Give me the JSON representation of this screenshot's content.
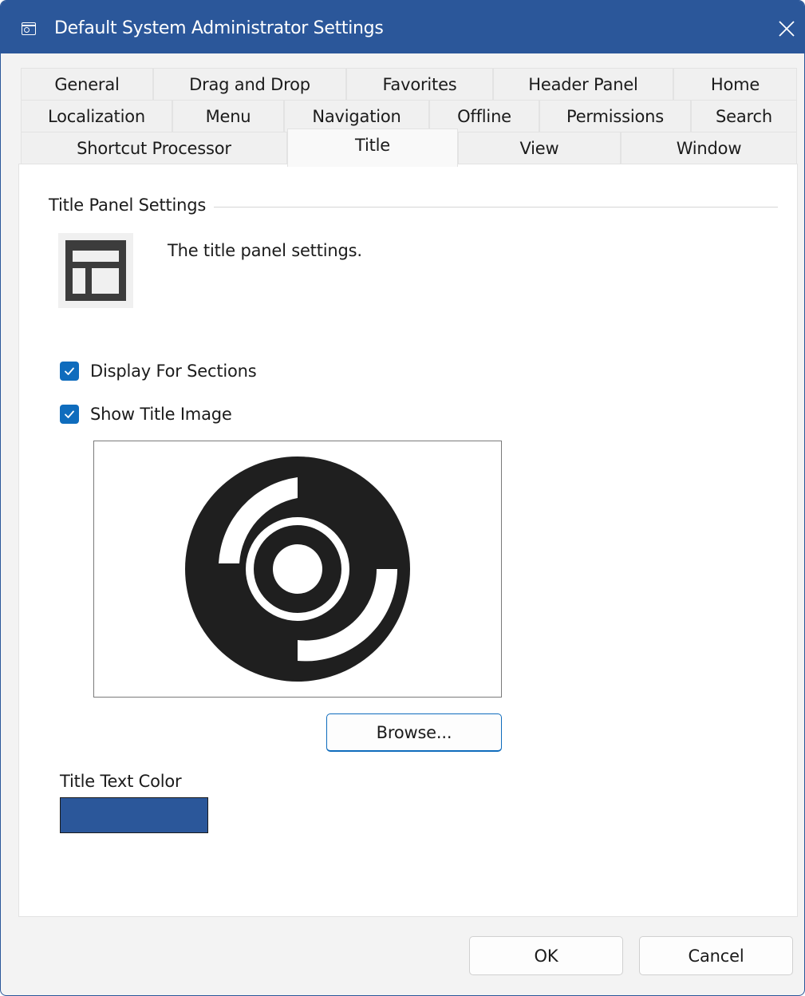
{
  "window": {
    "title": "Default System Administrator Settings",
    "title_bar_color": "#2b579a"
  },
  "icons": {
    "app": "settings-window-icon",
    "close": "close-icon",
    "panel": "title-panel-layout-icon",
    "title_image": "disc-logo-image"
  },
  "tabs": {
    "row1": [
      "General",
      "Drag and Drop",
      "Favorites",
      "Header Panel",
      "Home"
    ],
    "row2": [
      "Localization",
      "Menu",
      "Navigation",
      "Offline",
      "Permissions",
      "Search"
    ],
    "row3": [
      "Shortcut Processor",
      "Title",
      "View",
      "Window"
    ],
    "selected": "Title"
  },
  "panel": {
    "group_label": "Title Panel Settings",
    "description": "The title panel settings.",
    "display_for_sections": {
      "label": "Display For Sections",
      "checked": true
    },
    "show_title_image": {
      "label": "Show Title Image",
      "checked": true
    },
    "browse_label": "Browse...",
    "title_text_color_label": "Title Text Color",
    "title_text_color": "#2b579a",
    "accent_color": "#0f6cbd"
  },
  "footer": {
    "ok_label": "OK",
    "cancel_label": "Cancel"
  }
}
